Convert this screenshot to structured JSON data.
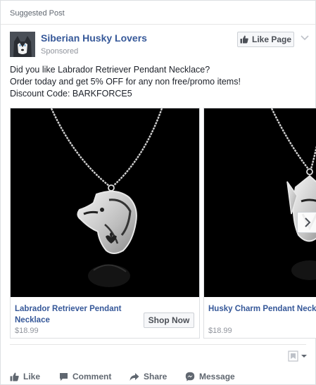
{
  "header": {
    "suggested_label": "Suggested Post",
    "page_name": "Siberian Husky Lovers",
    "sponsored_label": "Sponsored",
    "like_page_label": "Like Page"
  },
  "post": {
    "line1": "Did you like Labrador Retriever Pendant Necklace?",
    "line2": "Order today and get 5% OFF for any non free/promo items!",
    "line3": "Discount Code: BARKFORCE5"
  },
  "carousel": {
    "items": [
      {
        "title": "Labrador Retriever Pendant Necklace",
        "price": "$18.99",
        "cta": "Shop Now",
        "image": "labrador-pendant"
      },
      {
        "title": "Husky Charm Pendant Necklace",
        "price": "$18.99",
        "image": "husky-pendant"
      }
    ]
  },
  "actions": {
    "like": "Like",
    "comment": "Comment",
    "share": "Share",
    "message": "Message"
  },
  "colors": {
    "link_blue": "#365899",
    "muted_text": "#90949c",
    "action_text": "#606770",
    "border": "#dddfe2"
  }
}
